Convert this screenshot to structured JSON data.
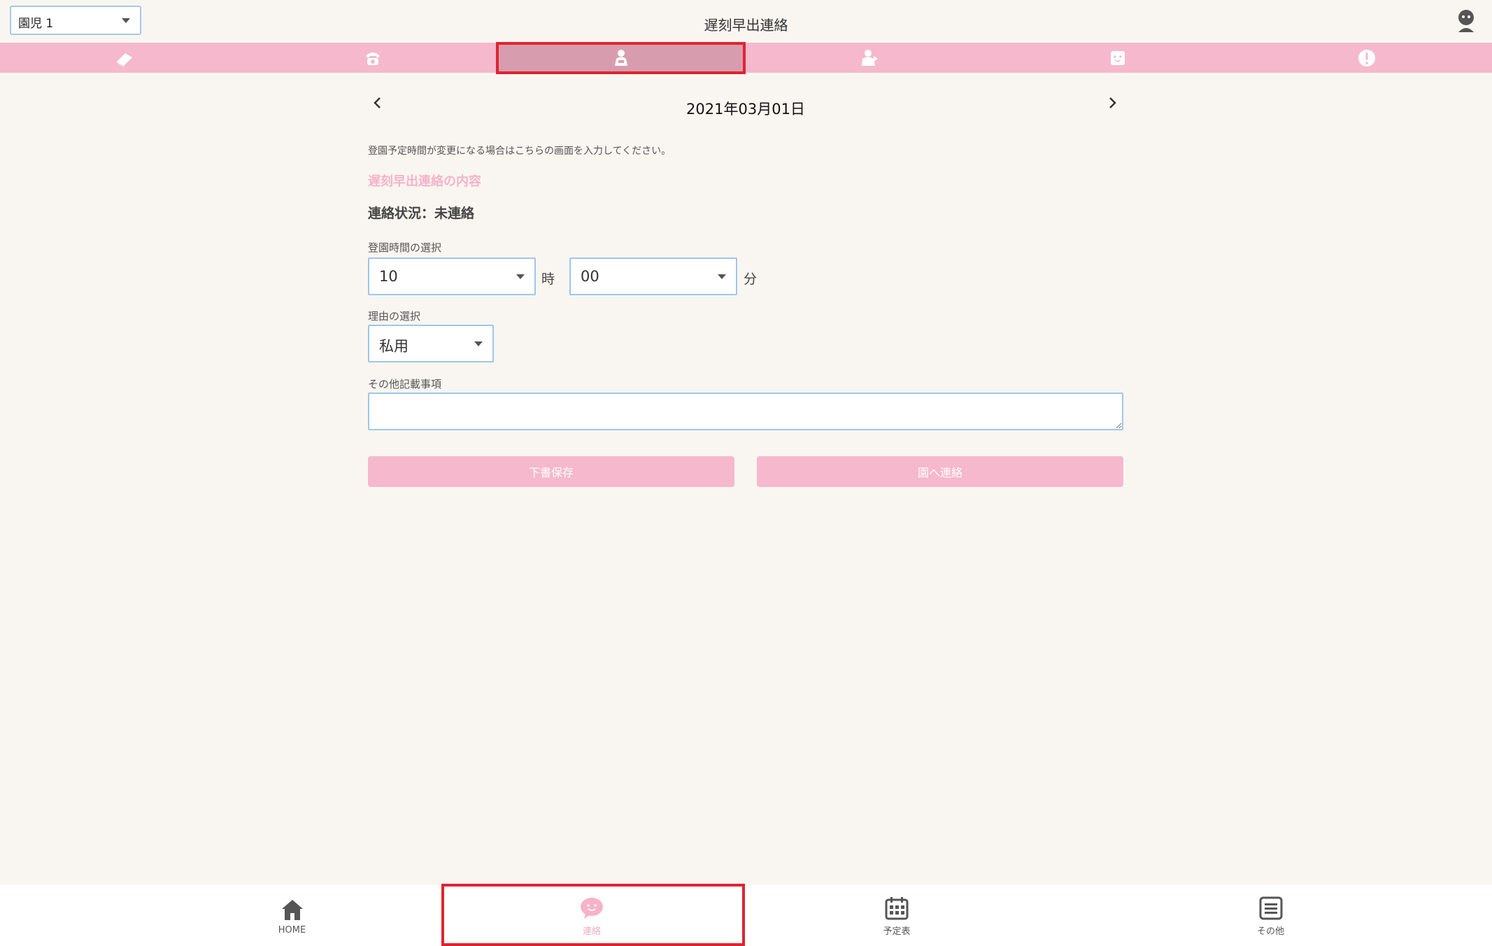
{
  "header": {
    "child_select": "園児 1",
    "title": "遅刻早出連絡"
  },
  "tabs": [
    {
      "icon": "notebook-icon",
      "active": false
    },
    {
      "icon": "telephone-icon",
      "active": false
    },
    {
      "icon": "child-late-icon",
      "active": true
    },
    {
      "icon": "child-pickup-icon",
      "active": false
    },
    {
      "icon": "face-card-icon",
      "active": false
    },
    {
      "icon": "alert-icon",
      "active": false
    }
  ],
  "date_nav": {
    "date": "2021年03月01日"
  },
  "form": {
    "info": "登園予定時間が変更になる場合はこちらの画面を入力してください。",
    "heading": "遅刻早出連絡の内容",
    "status": "連絡状況：未連絡",
    "time_label": "登園時間の選択",
    "hour_value": "10",
    "hour_unit": "時",
    "minute_value": "00",
    "minute_unit": "分",
    "reason_label": "理由の選択",
    "reason_value": "私用",
    "notes_label": "その他記載事項",
    "notes_value": "",
    "draft_button": "下書保存",
    "send_button": "園へ連絡"
  },
  "bottom_nav": [
    {
      "icon": "home-icon",
      "label": "HOME",
      "active": false
    },
    {
      "icon": "chat-bubble-icon",
      "label": "連絡",
      "active": true
    },
    {
      "icon": "calendar-icon",
      "label": "予定表",
      "active": false
    },
    {
      "icon": "menu-list-icon",
      "label": "その他",
      "active": false
    }
  ],
  "colors": {
    "accent_pink": "#f5b8cd",
    "active_tab": "#d79daf",
    "highlight_red": "#e0242f",
    "background": "#f9f6f1"
  }
}
